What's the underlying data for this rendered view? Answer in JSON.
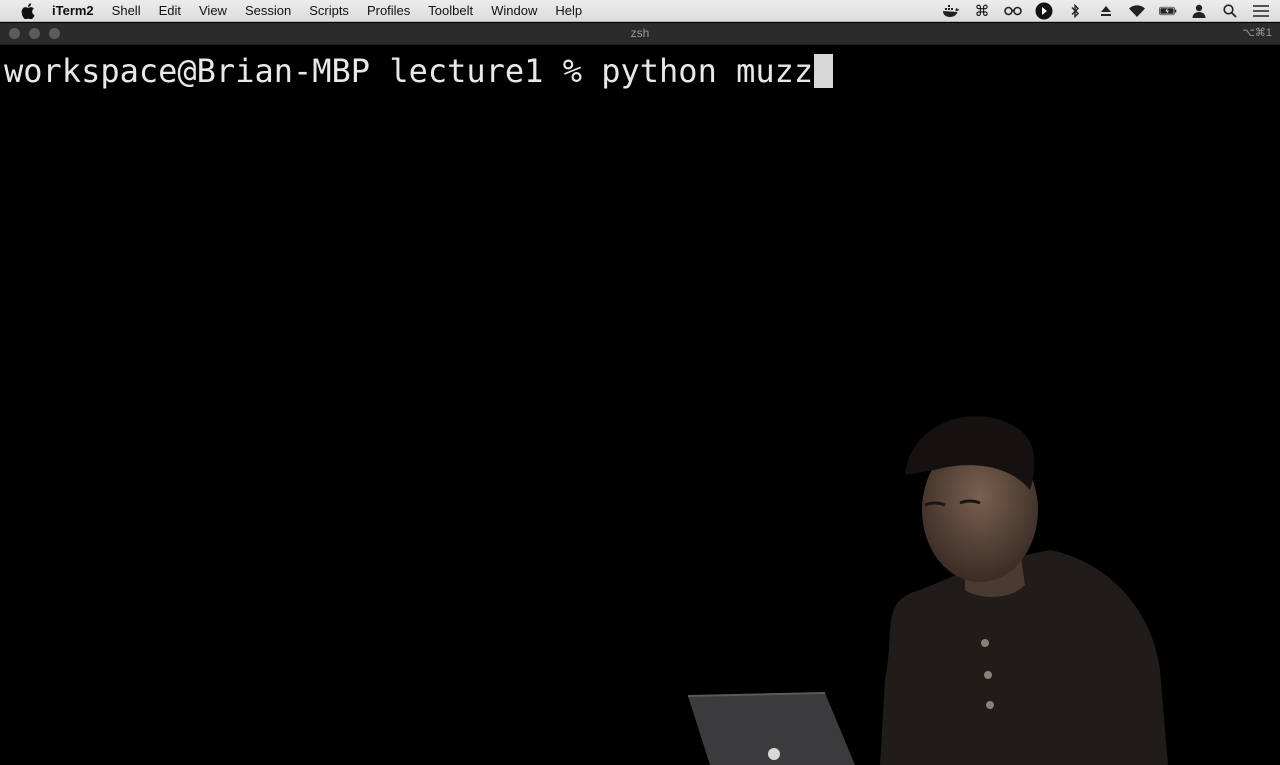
{
  "menubar": {
    "app_name": "iTerm2",
    "items": [
      "Shell",
      "Edit",
      "View",
      "Session",
      "Scripts",
      "Profiles",
      "Toolbelt",
      "Window",
      "Help"
    ],
    "status_icons": [
      "docker-icon",
      "command-icon",
      "glasses-icon",
      "play-circle-icon",
      "bluetooth-icon",
      "eject-icon",
      "wifi-icon",
      "battery-icon",
      "user-icon",
      "search-icon",
      "list-icon"
    ]
  },
  "window": {
    "title": "zsh",
    "shortcut": "⌥⌘1"
  },
  "terminal": {
    "prompt": "workspace@Brian-MBP lecture1 % ",
    "command": "python muzz"
  },
  "colors": {
    "terminal_bg": "#000000",
    "terminal_fg": "#e8e8e8",
    "menubar_bg": "#e5e5e5",
    "titlebar_bg": "#2b2b2b"
  }
}
